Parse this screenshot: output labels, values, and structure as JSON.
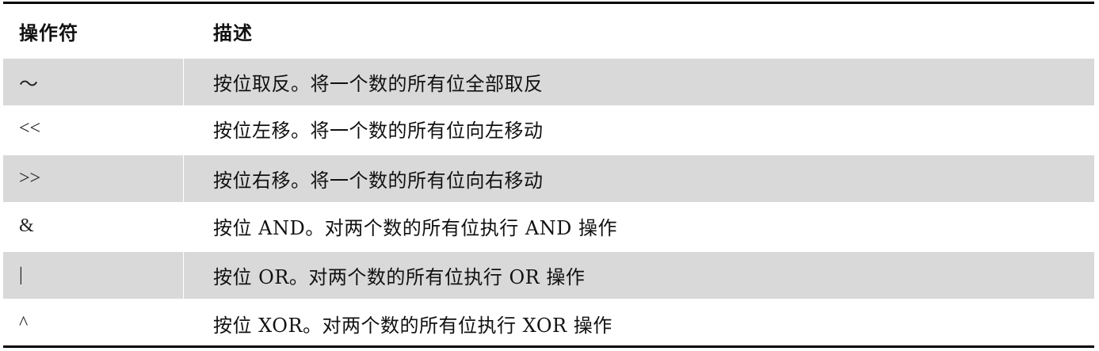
{
  "table": {
    "headers": {
      "operator": "操作符",
      "description": "描述"
    },
    "rows": [
      {
        "operator": "～",
        "description": "按位取反。将一个数的所有位全部取反"
      },
      {
        "operator": "<<",
        "description": "按位左移。将一个数的所有位向左移动"
      },
      {
        "operator": ">>",
        "description": "按位右移。将一个数的所有位向右移动"
      },
      {
        "operator": "&",
        "description": "按位 AND。对两个数的所有位执行 AND 操作"
      },
      {
        "operator": "|",
        "description": "按位 OR。对两个数的所有位执行 OR 操作"
      },
      {
        "operator": "^",
        "description": "按位 XOR。对两个数的所有位执行 XOR 操作"
      }
    ]
  },
  "colors": {
    "shaded_row": "#d9d9d9",
    "rule": "#000000"
  }
}
